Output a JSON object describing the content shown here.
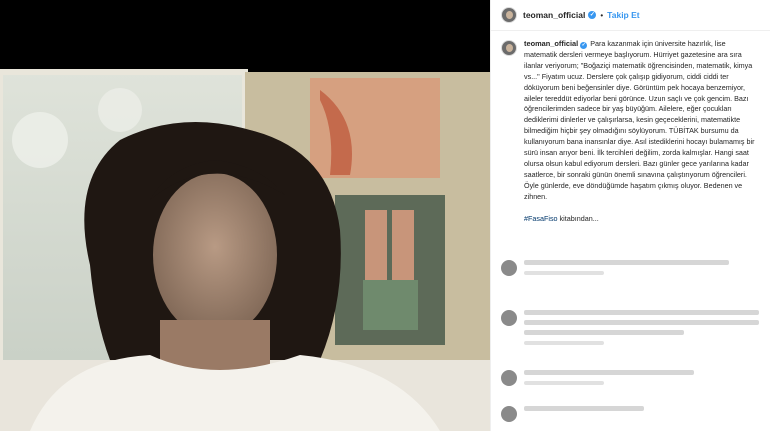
{
  "header": {
    "username": "teoman_official",
    "verified_glyph": "✓",
    "separator": "•",
    "follow_label": "Takip Et"
  },
  "caption": {
    "username": "teoman_official",
    "text": "Para kazanmak için üniversite hazırlık, lise matematik dersleri vermeye başlıyorum. Hürriyet gazetesine ara sıra ilanlar veriyorum; \"Boğaziçi matematik öğrencisinden, matematik, kimya vs...\" Fiyatım ucuz. Derslere çok çalışıp gidiyorum, ciddi ciddi ter döküyorum beni beğensinler diye. Görüntüm pek hocaya benzemiyor, aileler tereddüt ediyorlar beni görünce. Uzun saçlı ve çok gencim. Bazı öğrencilerimden sadece bir yaş büyüğüm. Ailelere, eğer çocukları dediklerimi dinlerler ve çalışırlarsa, kesin geçeceklerini, matematikte bilmediğim hiçbir şey olmadığını söylüyorum. TÜBİTAK bursumu da kullanıyorum bana inansınlar diye. Asıl istediklerini hocayı bulamamış bir sürü insan arıyor beni. İlk tercihleri değilim, zorda kalmışlar. Hangi saat olursa olsun kabul ediyorum dersleri. Bazı günler gece yarılarına kadar saatlerce, bir sonraki günün önemli sınavına çalıştırıyorum öğrencileri. Öyle günlerde, eve döndüğümde haşatım çıkmış oluyor. Bedenen ve zihnen.",
    "hashtag": "#FasaFiso",
    "hashtag_suffix": " kitabından..."
  },
  "icons": {
    "header_avatar": "avatar",
    "caption_avatar": "avatar",
    "verified": "verified-badge-icon"
  },
  "colors": {
    "accent": "#3897f0",
    "hashtag": "#00376b"
  }
}
